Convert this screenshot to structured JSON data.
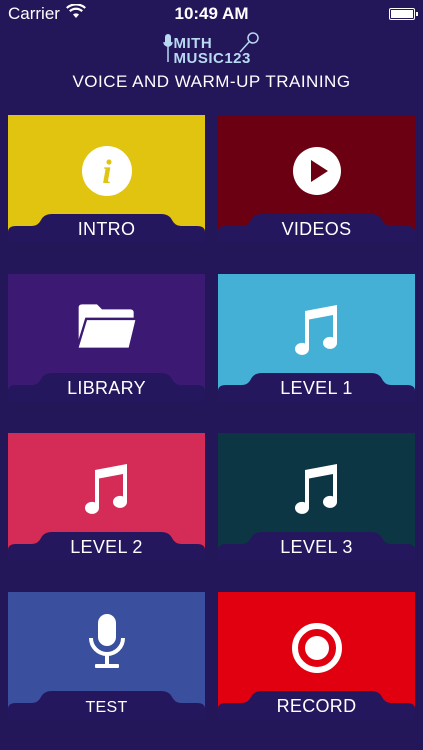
{
  "status_bar": {
    "carrier": "Carrier",
    "time": "10:49 AM"
  },
  "logo": {
    "line1": "MITH",
    "line2": "MUSIC123"
  },
  "page_title": "VOICE AND WARM-UP TRAINING",
  "tiles": [
    {
      "label": "INTRO",
      "color": "#e0c40f",
      "icon": "info-icon"
    },
    {
      "label": "VIDEOS",
      "color": "#6b0013",
      "icon": "play-icon"
    },
    {
      "label": "LIBRARY",
      "color": "#3c1a73",
      "icon": "folder-icon"
    },
    {
      "label": "LEVEL 1",
      "color": "#45b0d6",
      "icon": "music-note-icon"
    },
    {
      "label": "LEVEL 2",
      "color": "#d42c56",
      "icon": "music-note-icon"
    },
    {
      "label": "LEVEL 3",
      "color": "#0d3644",
      "icon": "music-note-icon"
    },
    {
      "label": "TEST",
      "color": "#3a4f9e",
      "icon": "microphone-icon"
    },
    {
      "label": "RECORD",
      "color": "#e00010",
      "icon": "record-icon"
    }
  ],
  "tab_color": "#25175e"
}
